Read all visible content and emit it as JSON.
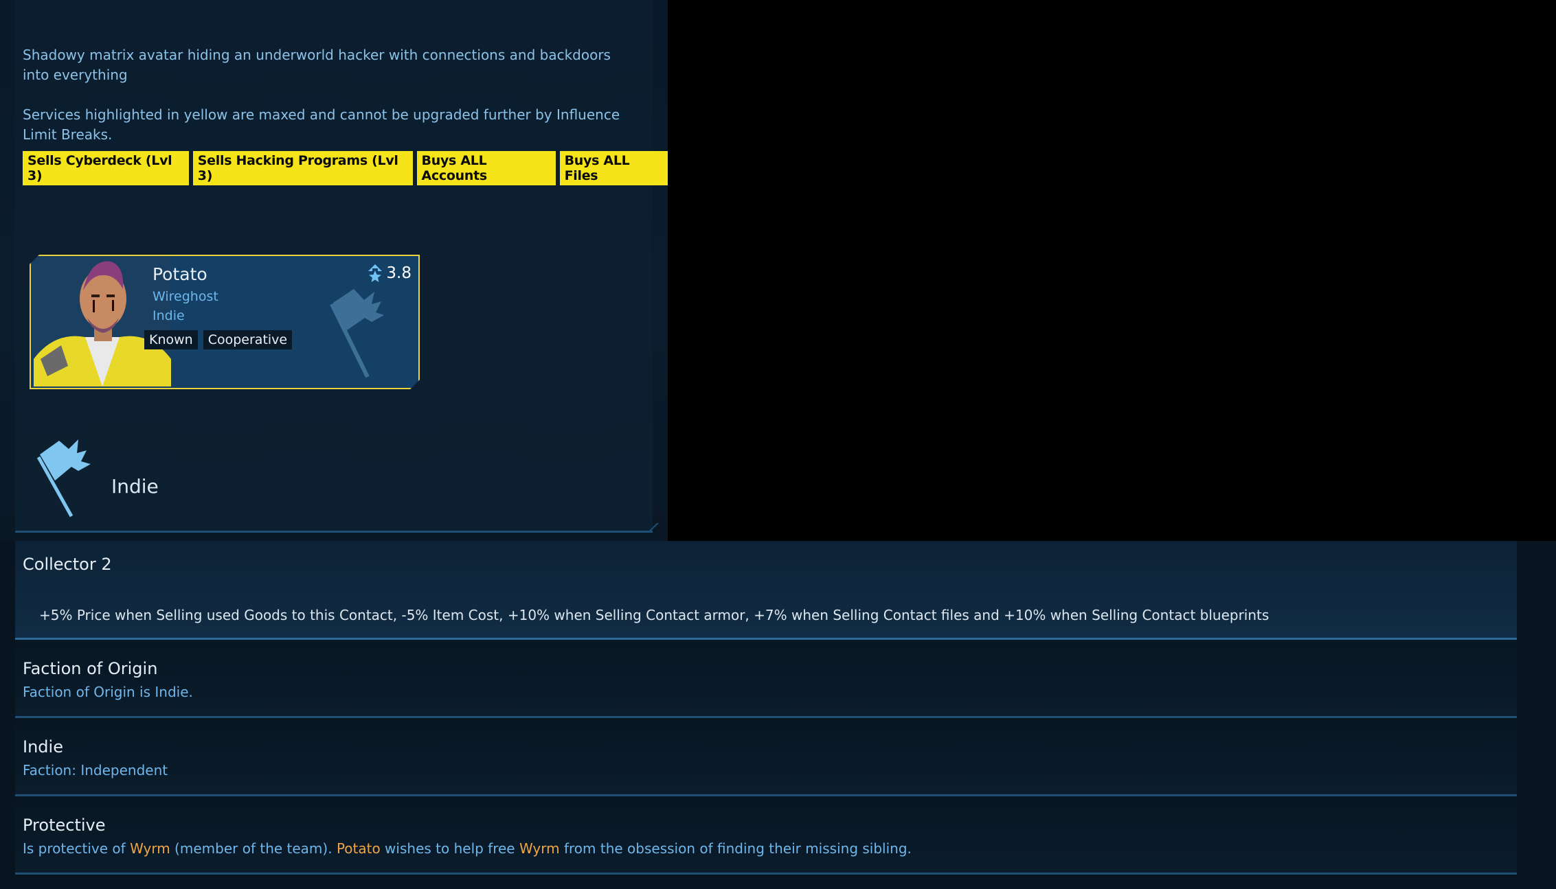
{
  "description": {
    "line1": "Shadowy matrix avatar hiding an underworld hacker with connections and backdoors into everything",
    "line2": "Services highlighted in yellow are maxed and cannot be upgraded further by Influence Limit Breaks."
  },
  "service_tags": [
    "Sells Cyberdeck (Lvl 3)",
    "Sells Hacking Programs (Lvl 3)",
    "Buys ALL Accounts",
    "Buys ALL Files"
  ],
  "contact_card": {
    "name": "Potato",
    "role": "Wireghost",
    "faction": "Indie",
    "rating": "3.8",
    "tags": [
      "Known",
      "Cooperative"
    ]
  },
  "faction_header": {
    "name": "Indie"
  },
  "sections": {
    "collector": {
      "title": "Collector 2",
      "text": "+5% Price when Selling used Goods to this Contact, -5% Item Cost, +10% when Selling Contact armor, +7% when Selling Contact files and +10% when Selling Contact blueprints"
    },
    "origin": {
      "title": "Faction of Origin",
      "text": "Faction of Origin is Indie."
    },
    "indie": {
      "title": "Indie",
      "text": "Faction: Independent"
    },
    "protective": {
      "title": "Protective",
      "text_parts": [
        "Is protective of ",
        "Wyrm",
        " (member of the team). ",
        "Potato",
        " wishes to help free ",
        "Wyrm",
        " from the obsession of finding their missing sibling."
      ]
    }
  },
  "colors": {
    "highlight_yellow": "#f5e41a",
    "accent_blue": "#6fb6ea",
    "name_orange": "#f0a545"
  }
}
